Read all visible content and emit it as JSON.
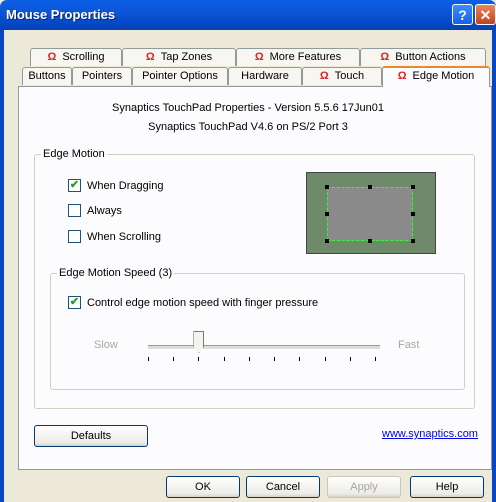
{
  "window": {
    "title": "Mouse Properties",
    "help_glyph": "?",
    "close_glyph": "✕"
  },
  "tabs_top": [
    {
      "label": "Scrolling"
    },
    {
      "label": "Tap Zones"
    },
    {
      "label": "More Features"
    },
    {
      "label": "Button Actions"
    }
  ],
  "tabs_bottom": [
    {
      "label": "Buttons"
    },
    {
      "label": "Pointers"
    },
    {
      "label": "Pointer Options"
    },
    {
      "label": "Hardware"
    },
    {
      "label": "Touch"
    },
    {
      "label": "Edge Motion"
    }
  ],
  "tab_icon_glyph": "Ω",
  "version": {
    "line1": "Synaptics TouchPad Properties - Version 5.5.6 17Jun01",
    "line2": "Synaptics TouchPad V4.6 on PS/2 Port 3"
  },
  "edge_motion": {
    "legend": "Edge Motion",
    "options": [
      {
        "label": "When Dragging",
        "checked": true,
        "mark": "✔"
      },
      {
        "label": "Always",
        "checked": false,
        "mark": ""
      },
      {
        "label": "When Scrolling",
        "checked": false,
        "mark": ""
      }
    ]
  },
  "speed": {
    "legend": "Edge Motion Speed (3)",
    "pressure_label": "Control edge motion speed with finger pressure",
    "pressure_checked": true,
    "pressure_mark": "✔",
    "slow_label": "Slow",
    "fast_label": "Fast",
    "level": 3,
    "ticks": 10
  },
  "defaults_label": "Defaults",
  "link_label": "www.synaptics.com",
  "buttons": {
    "ok": "OK",
    "cancel": "Cancel",
    "apply": "Apply",
    "help": "Help"
  }
}
